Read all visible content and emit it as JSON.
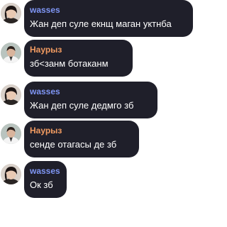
{
  "colors": {
    "background": "#ffffff",
    "bubble": "#1f1f2a",
    "text": "#ffffff",
    "sender_wasses": "#7f96f5",
    "sender_nauryz": "#f29b61"
  },
  "messages": [
    {
      "sender": "wasses",
      "sender_color": "#7f96f5",
      "avatar": "user-avatar-wasses",
      "text": "Жан деп суле екнщ маган уктнба"
    },
    {
      "sender": "Наурыз",
      "sender_color": "#f29b61",
      "avatar": "user-avatar-nauryz",
      "text": "зб<занм ботаканм"
    },
    {
      "sender": "wasses",
      "sender_color": "#7f96f5",
      "avatar": "user-avatar-wasses",
      "text": "Жан деп суле дедмго зб"
    },
    {
      "sender": "Наурыз",
      "sender_color": "#f29b61",
      "avatar": "user-avatar-nauryz",
      "text": "сенде отагасы де зб"
    },
    {
      "sender": "wasses",
      "sender_color": "#7f96f5",
      "avatar": "user-avatar-wasses",
      "text": "Ок зб"
    }
  ]
}
